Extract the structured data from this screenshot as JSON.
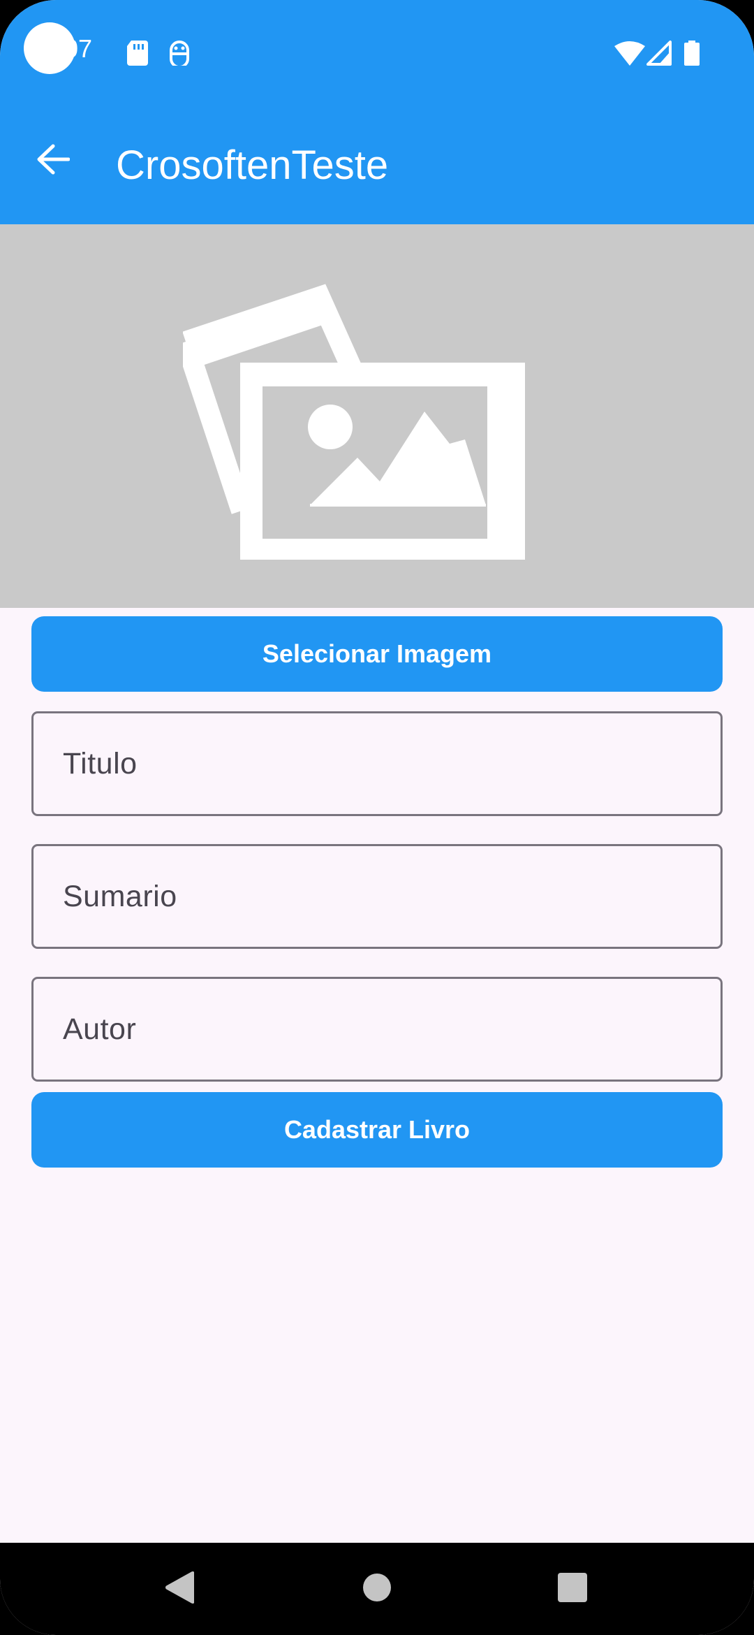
{
  "status_bar": {
    "time": "07",
    "icons": [
      "sd-card-icon",
      "debug-icon",
      "wifi-icon",
      "signal-icon",
      "battery-icon"
    ]
  },
  "app_bar": {
    "title": "CrosoftenTeste",
    "back_icon": "arrow-left-icon"
  },
  "image_preview": {
    "icon": "image-placeholder-icon"
  },
  "form": {
    "select_image_label": "Selecionar Imagem",
    "fields": [
      {
        "label": "Titulo"
      },
      {
        "label": "Sumario"
      },
      {
        "label": "Autor"
      }
    ],
    "submit_label": "Cadastrar Livro"
  },
  "nav_bar": {
    "icons": [
      "back-triangle-icon",
      "home-circle-icon",
      "recents-square-icon"
    ]
  },
  "colors": {
    "primary": "#2196f3",
    "background": "#fcf5fc",
    "placeholder_bg": "#c9c9c9",
    "outline": "#79747e",
    "field_text": "#49454f"
  }
}
